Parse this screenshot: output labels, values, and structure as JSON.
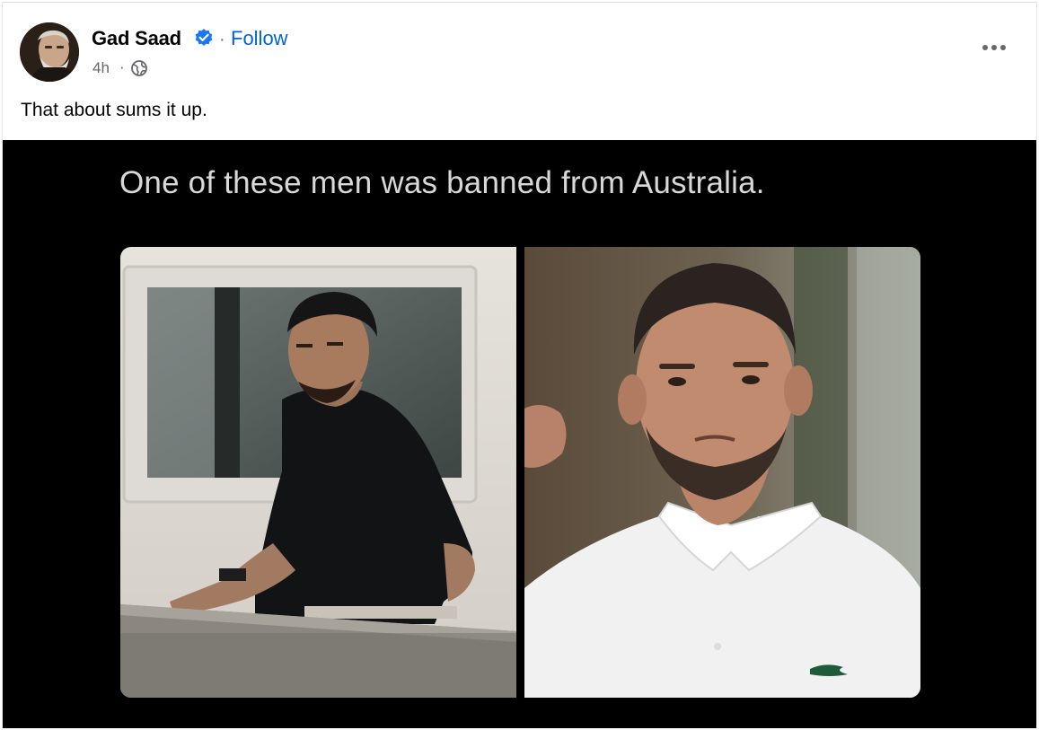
{
  "post": {
    "author": "Gad Saad",
    "follow_label": "Follow",
    "separator": "·",
    "time": "4h",
    "text": "That about sums it up.",
    "privacy_icon": "globe-icon",
    "verified_icon": "verified-badge-icon",
    "more_icon": "more-options-icon"
  },
  "media": {
    "caption": "One of these men was banned from Australia."
  },
  "colors": {
    "link": "#0064d1",
    "verified": "#1877f2",
    "secondary_text": "#65676b",
    "media_background": "#000000"
  }
}
